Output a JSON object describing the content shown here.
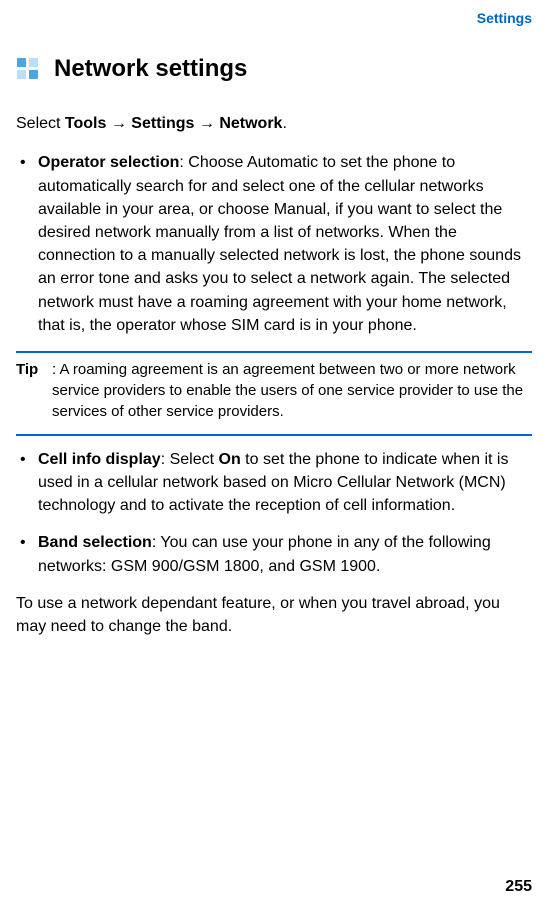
{
  "header": {
    "section_label": "Settings"
  },
  "title": "Network settings",
  "intro": {
    "prefix": "Select ",
    "path_tools": "Tools",
    "arrow": " → ",
    "path_settings": "Settings",
    "path_network": "Network",
    "suffix": "."
  },
  "bullets": {
    "b1": {
      "label": "Operator selection",
      "text": ": Choose Automatic to set the phone to automatically search for and select one of the cellular networks available in your area, or choose Manual, if you want to select the desired network manually from a list of networks. When the connection to a manually selected network is lost, the phone sounds an error tone and asks you to select a network again. The selected network must have a roaming agreement with your home network, that is, the operator whose SIM card is in your phone."
    },
    "b2": {
      "label": "Cell info display",
      "text_pre": ": Select ",
      "on": "On",
      "text_post": " to set the phone to indicate when it is used in a cellular network based on Micro Cellular Network (MCN) technology and to activate the reception of cell information."
    },
    "b3": {
      "label": "Band selection",
      "text": ": You can use your phone in any of the following networks: GSM 900/GSM 1800, and GSM 1900."
    }
  },
  "tip": {
    "label": "Tip",
    "text": ": A roaming agreement is an agreement between two or more network service providers to enable the users of one service provider to use the services of other service providers."
  },
  "closing": "To use a network dependant feature, or when you travel abroad, you may need to change the band.",
  "page_number": "255"
}
